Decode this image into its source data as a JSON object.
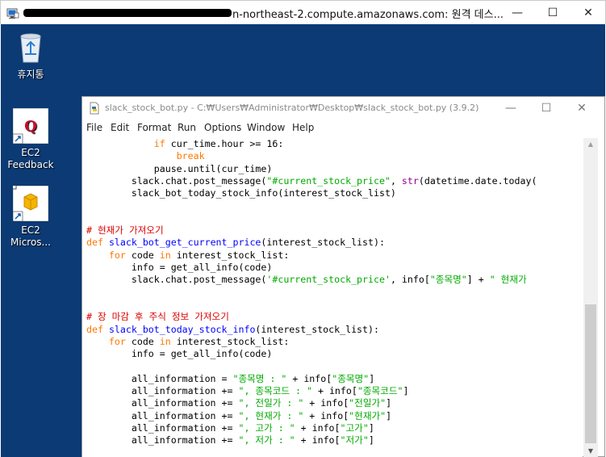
{
  "rdp_window": {
    "title": "-.....-.....-......-.....-.....-.....n-northeast-2.compute.amazonaws.com: 원격 데스...",
    "title_visible": "n-northeast-2.compute.amazonaws.com: 원격 데스...",
    "minimize": "—",
    "maximize": "☐",
    "close": "✕"
  },
  "desktop": {
    "icons": [
      {
        "label": "휴지통",
        "icon": "recycle-bin-icon"
      },
      {
        "label": "EC2\nFeedback",
        "icon": "ec2-feedback-icon"
      },
      {
        "label": "EC2\nMicros...",
        "icon": "ec2-microsoft-icon"
      }
    ]
  },
  "idle_window": {
    "title": "slack_stock_bot.py - C:₩Users₩Administrator₩Desktop₩slack_stock_bot.py (3.9.2)",
    "minimize": "—",
    "maximize": "☐",
    "close": "✕",
    "menu": [
      "File",
      "Edit",
      "Format",
      "Run",
      "Options",
      "Window",
      "Help"
    ]
  },
  "code_lines": [
    [
      {
        "t": "            "
      },
      {
        "t": "if",
        "c": "kw"
      },
      {
        "t": " cur_time.hour >= 16:"
      }
    ],
    [
      {
        "t": "                "
      },
      {
        "t": "break",
        "c": "kw"
      }
    ],
    [
      {
        "t": "            pause.until(cur_time)"
      }
    ],
    [
      {
        "t": "        slack.chat.post_message("
      },
      {
        "t": "\"#current_stock_price\"",
        "c": "st"
      },
      {
        "t": ", "
      },
      {
        "t": "str",
        "c": "fn2"
      },
      {
        "t": "(datetime.date.today("
      }
    ],
    [
      {
        "t": "        slack_bot_today_stock_info(interest_stock_list)"
      }
    ],
    [
      {
        "t": ""
      }
    ],
    [
      {
        "t": ""
      }
    ],
    [
      {
        "t": "# 현재가 가져오기",
        "c": "cm"
      }
    ],
    [
      {
        "t": "def",
        "c": "kw"
      },
      {
        "t": " "
      },
      {
        "t": "slack_bot_get_current_price",
        "c": "fn"
      },
      {
        "t": "(interest_stock_list):"
      }
    ],
    [
      {
        "t": "    "
      },
      {
        "t": "for",
        "c": "kw"
      },
      {
        "t": " code "
      },
      {
        "t": "in",
        "c": "kw"
      },
      {
        "t": " interest_stock_list:"
      }
    ],
    [
      {
        "t": "        info = get_all_info(code)"
      }
    ],
    [
      {
        "t": "        slack.chat.post_message("
      },
      {
        "t": "'#current_stock_price'",
        "c": "st"
      },
      {
        "t": ", info["
      },
      {
        "t": "\"종목명\"",
        "c": "st"
      },
      {
        "t": "] + "
      },
      {
        "t": "\" 현재가",
        "c": "st"
      }
    ],
    [
      {
        "t": ""
      }
    ],
    [
      {
        "t": ""
      }
    ],
    [
      {
        "t": "# 장 마감 후 주식 정보 가져오기",
        "c": "cm"
      }
    ],
    [
      {
        "t": "def",
        "c": "kw"
      },
      {
        "t": " "
      },
      {
        "t": "slack_bot_today_stock_info",
        "c": "fn"
      },
      {
        "t": "(interest_stock_list):"
      }
    ],
    [
      {
        "t": "    "
      },
      {
        "t": "for",
        "c": "kw"
      },
      {
        "t": " code "
      },
      {
        "t": "in",
        "c": "kw"
      },
      {
        "t": " interest_stock_list:"
      }
    ],
    [
      {
        "t": "        info = get_all_info(code)"
      }
    ],
    [
      {
        "t": ""
      }
    ],
    [
      {
        "t": "        all_information = "
      },
      {
        "t": "\"종목명 : \"",
        "c": "st"
      },
      {
        "t": " + info["
      },
      {
        "t": "\"종목명\"",
        "c": "st"
      },
      {
        "t": "]"
      }
    ],
    [
      {
        "t": "        all_information += "
      },
      {
        "t": "\", 종목코드 : \"",
        "c": "st"
      },
      {
        "t": " + info["
      },
      {
        "t": "\"종목코드\"",
        "c": "st"
      },
      {
        "t": "]"
      }
    ],
    [
      {
        "t": "        all_information += "
      },
      {
        "t": "\", 전일가 : \"",
        "c": "st"
      },
      {
        "t": " + info["
      },
      {
        "t": "\"전일가\"",
        "c": "st"
      },
      {
        "t": "]"
      }
    ],
    [
      {
        "t": "        all_information += "
      },
      {
        "t": "\", 현재가 : \"",
        "c": "st"
      },
      {
        "t": " + info["
      },
      {
        "t": "\"현재가\"",
        "c": "st"
      },
      {
        "t": "]"
      }
    ],
    [
      {
        "t": "        all_information += "
      },
      {
        "t": "\", 고가 : \"",
        "c": "st"
      },
      {
        "t": " + info["
      },
      {
        "t": "\"고가\"",
        "c": "st"
      },
      {
        "t": "]"
      }
    ],
    [
      {
        "t": "        all_information += "
      },
      {
        "t": "\", 저가 : \"",
        "c": "st"
      },
      {
        "t": " + info["
      },
      {
        "t": "\"저가\"",
        "c": "st"
      },
      {
        "t": "]"
      }
    ]
  ],
  "colors": {
    "desktop_bg": "#0b3a74",
    "keyword": "#ff7700",
    "function_name": "#0000ff",
    "string": "#00aa00",
    "comment": "#dd0000",
    "builtin": "#900090"
  }
}
